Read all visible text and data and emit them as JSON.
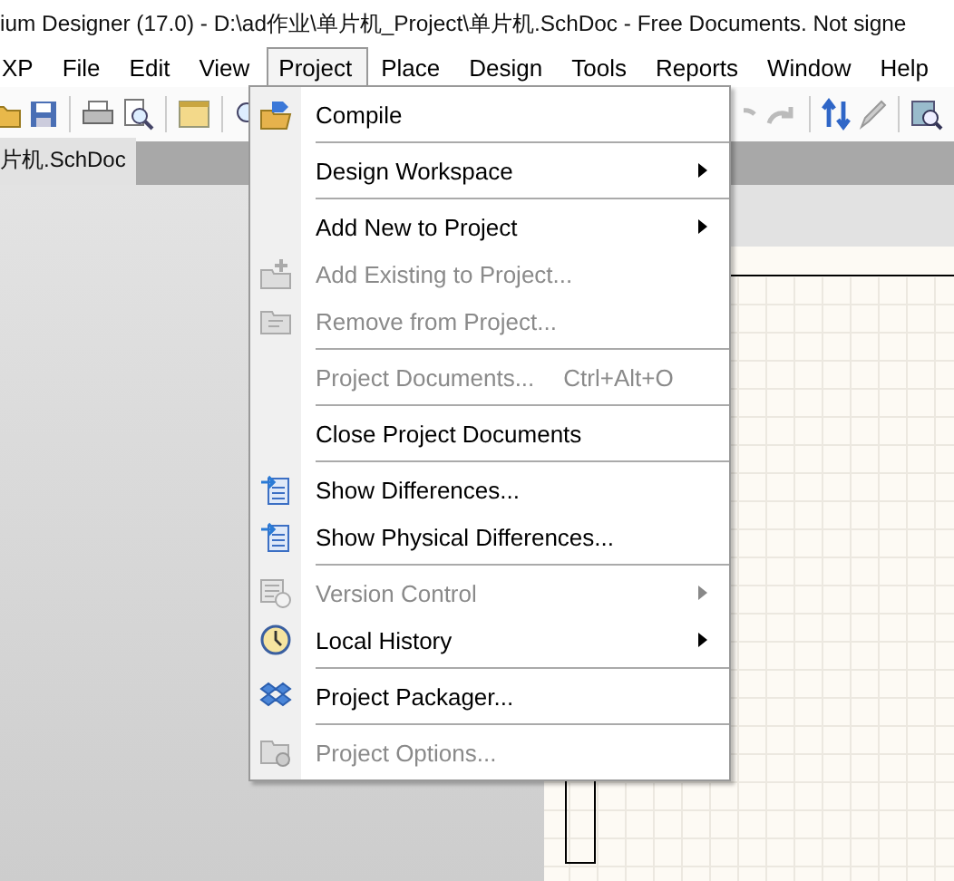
{
  "window": {
    "title": "ium Designer (17.0) - D:\\ad作业\\单片机_Project\\单片机.SchDoc - Free Documents. Not signe"
  },
  "menu_bar": [
    {
      "label": "XP",
      "selected": false
    },
    {
      "label": "File",
      "selected": false
    },
    {
      "label": "Edit",
      "selected": false
    },
    {
      "label": "View",
      "selected": false
    },
    {
      "label": "Project",
      "selected": true
    },
    {
      "label": "Place",
      "selected": false
    },
    {
      "label": "Design",
      "selected": false
    },
    {
      "label": "Tools",
      "selected": false
    },
    {
      "label": "Reports",
      "selected": false
    },
    {
      "label": "Window",
      "selected": false
    },
    {
      "label": "Help",
      "selected": false
    }
  ],
  "tabs": [
    {
      "label": "片机.SchDoc",
      "selected": true
    }
  ],
  "project_menu": [
    {
      "kind": "compile",
      "label": "Compile",
      "disabled": false,
      "submenu": false
    },
    {
      "kind": "separator"
    },
    {
      "kind": "plain",
      "label": "Design Workspace",
      "disabled": false,
      "submenu": true
    },
    {
      "kind": "separator"
    },
    {
      "kind": "plain",
      "label": "Add New to Project",
      "disabled": false,
      "submenu": true
    },
    {
      "kind": "add",
      "label": "Add Existing to Project...",
      "disabled": true,
      "submenu": false
    },
    {
      "kind": "remove",
      "label": "Remove from Project...",
      "disabled": true,
      "submenu": false
    },
    {
      "kind": "separator"
    },
    {
      "kind": "plain",
      "label": "Project Documents...",
      "shortcut": "Ctrl+Alt+O",
      "disabled": true,
      "submenu": false
    },
    {
      "kind": "separator"
    },
    {
      "kind": "plain",
      "label": "Close Project Documents",
      "disabled": false,
      "submenu": false
    },
    {
      "kind": "separator"
    },
    {
      "kind": "diff",
      "label": "Show Differences...",
      "disabled": false,
      "submenu": false
    },
    {
      "kind": "diff",
      "label": "Show Physical Differences...",
      "disabled": false,
      "submenu": false
    },
    {
      "kind": "separator"
    },
    {
      "kind": "version",
      "label": "Version Control",
      "disabled": true,
      "submenu": true
    },
    {
      "kind": "clock",
      "label": "Local History",
      "disabled": false,
      "submenu": true
    },
    {
      "kind": "separator"
    },
    {
      "kind": "packager",
      "label": "Project Packager...",
      "disabled": false,
      "submenu": false
    },
    {
      "kind": "separator"
    },
    {
      "kind": "options",
      "label": "Project Options...",
      "disabled": true,
      "submenu": false
    }
  ]
}
